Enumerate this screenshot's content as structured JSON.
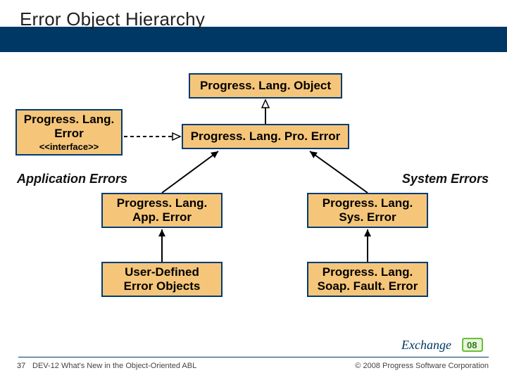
{
  "title": "Error Object Hierarchy",
  "boxes": {
    "object": {
      "l1": "Progress. Lang. Object"
    },
    "error": {
      "l1": "Progress. Lang.",
      "l2": "Error",
      "sub": "<<interface>>"
    },
    "proerror": {
      "l1": "Progress. Lang. Pro. Error"
    },
    "apperror": {
      "l1": "Progress. Lang.",
      "l2": "App. Error"
    },
    "syserror": {
      "l1": "Progress. Lang.",
      "l2": "Sys. Error"
    },
    "userdef": {
      "l1": "User-Defined",
      "l2": "Error Objects"
    },
    "soapfault": {
      "l1": "Progress. Lang.",
      "l2": "Soap. Fault. Error"
    }
  },
  "categories": {
    "app": "Application Errors",
    "sys": "System Errors"
  },
  "footer": {
    "page": "37",
    "title": "DEV-12 What's New in the Object-Oriented ABL",
    "copyright": "© 2008 Progress Software Corporation",
    "logo_text": "Exchange",
    "logo_year": "08"
  }
}
